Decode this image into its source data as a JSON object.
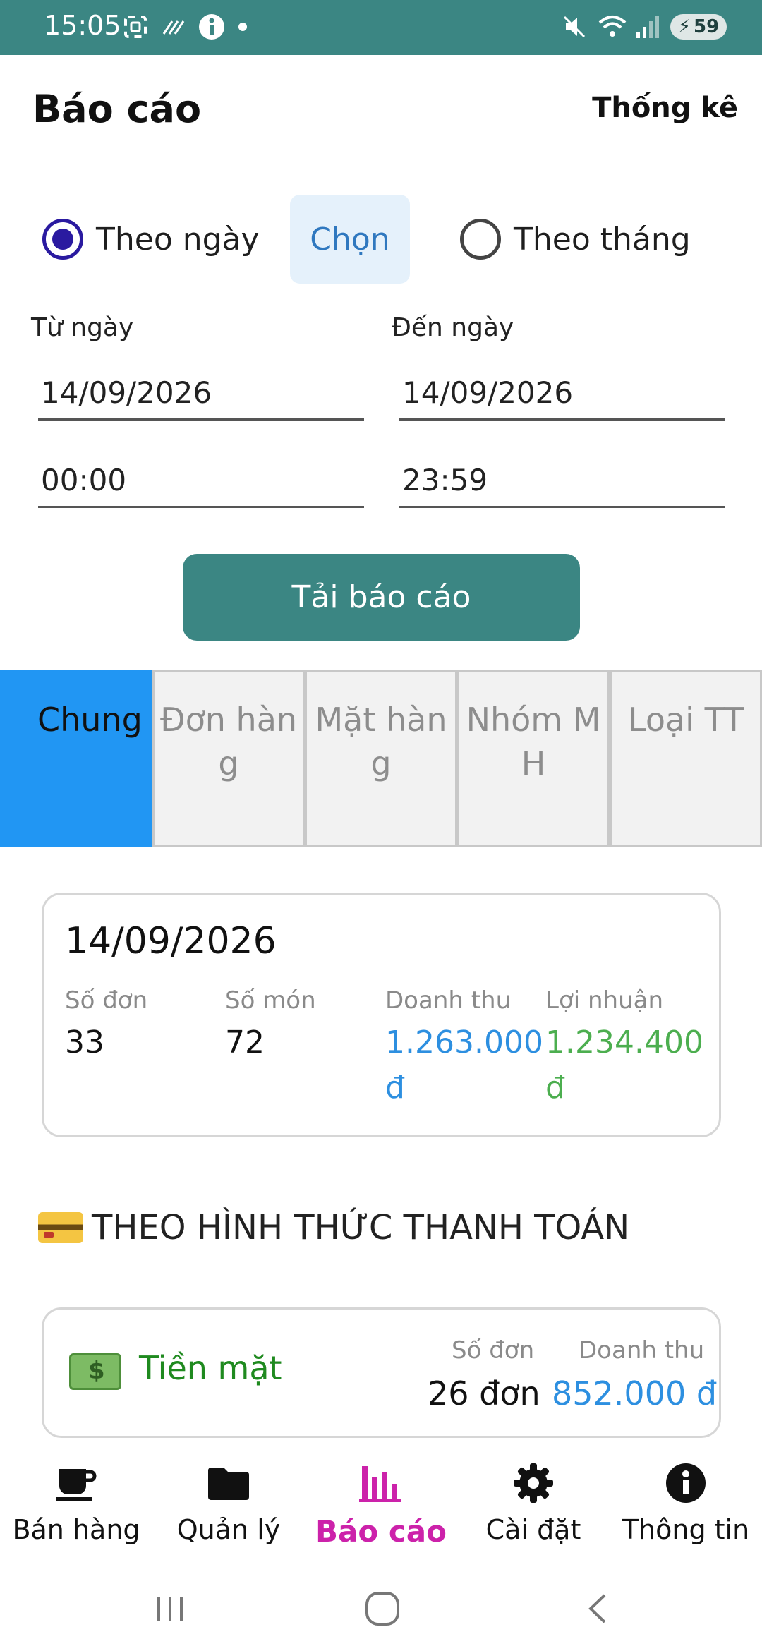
{
  "status_bar": {
    "time": "15:05",
    "battery": "59",
    "colors": {
      "background": "#3b8683"
    }
  },
  "header": {
    "title": "Báo cáo",
    "stats_link": "Thống kê"
  },
  "period": {
    "daily_label": "Theo ngày",
    "daily_checked": true,
    "choose_label": "Chọn",
    "monthly_label": "Theo tháng",
    "monthly_checked": false
  },
  "date_range": {
    "from_label": "Từ ngày",
    "to_label": "Đến ngày",
    "from_date": "14/09/2026",
    "to_date": "14/09/2026",
    "from_time": "00:00",
    "to_time": "23:59"
  },
  "load_button": "Tải báo cáo",
  "tabs": [
    {
      "label": "Chung",
      "active": true
    },
    {
      "label": "Đơn hàng",
      "active": false
    },
    {
      "label": "Mặt hàng",
      "active": false
    },
    {
      "label": "Nhóm MH",
      "active": false
    },
    {
      "label": "Loại TT",
      "active": false
    }
  ],
  "summary": {
    "date": "14/09/2026",
    "orders_label": "Số đơn",
    "orders_value": "33",
    "items_label": "Số món",
    "items_value": "72",
    "revenue_label": "Doanh thu",
    "revenue_value": "1.263.000 đ",
    "profit_label": "Lợi nhuận",
    "profit_value": "1.234.400 đ"
  },
  "payment_section": {
    "title": "THEO HÌNH THỨC THANH TOÁN",
    "icon": "credit-card-icon",
    "items": [
      {
        "name": "Tiền mặt",
        "icon": "cash-icon",
        "orders_label": "Số đơn",
        "orders_value": "26 đơn",
        "revenue_label": "Doanh thu",
        "revenue_value": "852.000 đ"
      }
    ]
  },
  "bottom_nav": [
    {
      "label": "Bán hàng",
      "icon": "coffee-cup-icon",
      "active": false
    },
    {
      "label": "Quản lý",
      "icon": "folder-icon",
      "active": false
    },
    {
      "label": "Báo cáo",
      "icon": "bar-chart-icon",
      "active": true
    },
    {
      "label": "Cài đặt",
      "icon": "gear-icon",
      "active": false
    },
    {
      "label": "Thông tin",
      "icon": "info-icon",
      "active": false
    }
  ],
  "colors": {
    "accent": "#3b8683",
    "tab_active": "#2196f3",
    "revenue": "#2d8fe0",
    "profit": "#4cae4f",
    "cash": "#1f8a1f",
    "nav_active": "#cc22aa"
  }
}
